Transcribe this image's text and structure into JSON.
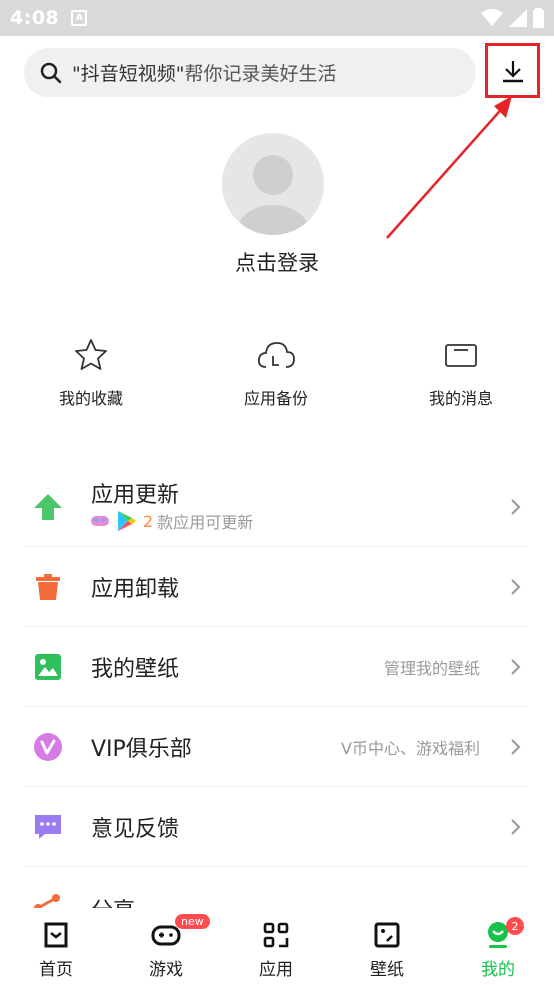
{
  "status_bar": {
    "time": "4:08"
  },
  "search": {
    "highlight": "\"抖音短视频\"",
    "rest": "帮你记录美好生活"
  },
  "profile": {
    "login_label": "点击登录"
  },
  "quick_actions": [
    {
      "label": "我的收藏",
      "icon": "star-icon"
    },
    {
      "label": "应用备份",
      "icon": "cloud-icon"
    },
    {
      "label": "我的消息",
      "icon": "message-icon"
    }
  ],
  "menu": {
    "update": {
      "title": "应用更新",
      "count": "2",
      "suffix": "款应用可更新"
    },
    "uninstall": {
      "title": "应用卸载"
    },
    "wallpaper": {
      "title": "我的壁纸",
      "sub": "管理我的壁纸"
    },
    "vip": {
      "title": "VIP俱乐部",
      "sub": "V币中心、游戏福利"
    },
    "feedback": {
      "title": "意见反馈"
    },
    "share": {
      "title": "分享"
    }
  },
  "tabs": [
    {
      "label": "首页"
    },
    {
      "label": "游戏",
      "badge": "new"
    },
    {
      "label": "应用"
    },
    {
      "label": "壁纸"
    },
    {
      "label": "我的",
      "badge": "2",
      "active": true
    }
  ],
  "colors": {
    "accent": "#17c24b",
    "badge": "#ff4d4f",
    "highlight_box": "#e5242a"
  }
}
